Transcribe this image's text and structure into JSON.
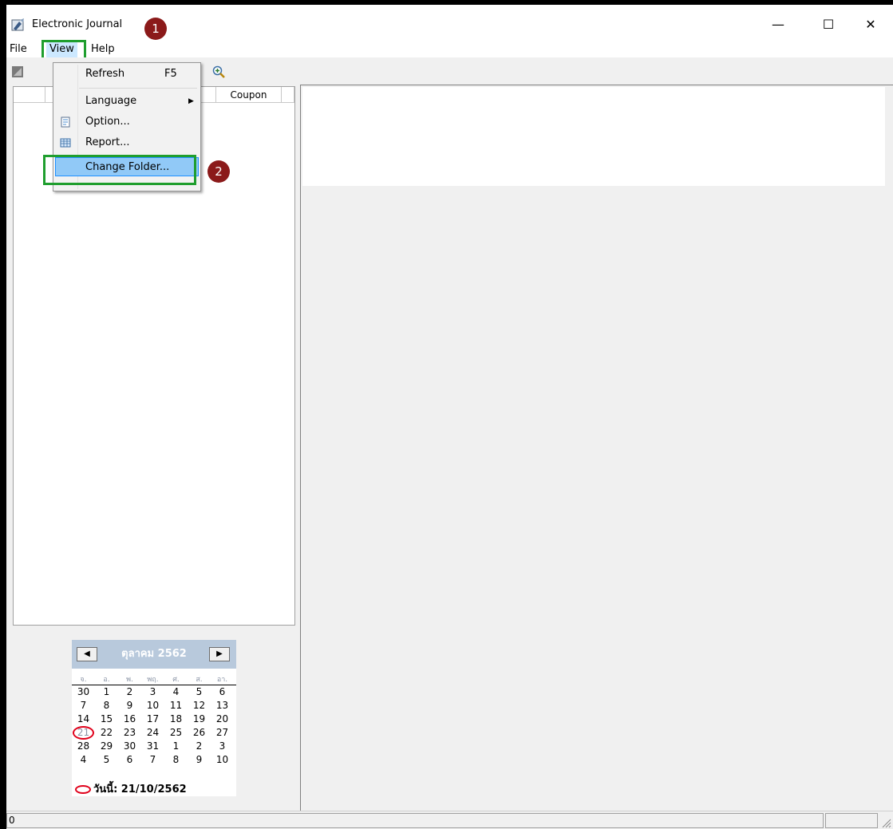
{
  "window": {
    "title": "Electronic Journal",
    "controls": {
      "minimize": "—",
      "maximize": "☐",
      "close": "✕"
    }
  },
  "markers": {
    "step1": "1",
    "step2": "2"
  },
  "menubar": {
    "file": "File",
    "view": "View",
    "help": "Help"
  },
  "view_menu": {
    "refresh": {
      "label": "Refresh",
      "shortcut": "F5"
    },
    "language": {
      "label": "Language"
    },
    "option": {
      "label": "Option..."
    },
    "report": {
      "label": "Report..."
    },
    "change_folder": {
      "label": "Change Folder..."
    }
  },
  "list": {
    "columns": [
      "",
      "",
      "Coupon",
      ""
    ]
  },
  "calendar": {
    "month_title": "ตุลาคม 2562",
    "weekdays": [
      "จ.",
      "อ.",
      "พ.",
      "พฤ.",
      "ศ.",
      "ส.",
      "อา."
    ],
    "weeks": [
      [
        "30",
        "1",
        "2",
        "3",
        "4",
        "5",
        "6"
      ],
      [
        "7",
        "8",
        "9",
        "10",
        "11",
        "12",
        "13"
      ],
      [
        "14",
        "15",
        "16",
        "17",
        "18",
        "19",
        "20"
      ],
      [
        "21",
        "22",
        "23",
        "24",
        "25",
        "26",
        "27"
      ],
      [
        "28",
        "29",
        "30",
        "31",
        "1",
        "2",
        "3"
      ],
      [
        "4",
        "5",
        "6",
        "7",
        "8",
        "9",
        "10"
      ]
    ],
    "today_label": "วันนี้: 21/10/2562"
  },
  "statusbar": {
    "count": "0"
  },
  "colors": {
    "highlight_border": "#1f9e2e",
    "marker": "#8b1a1a",
    "menu_hover": "#91c9f7",
    "calendar_header": "#b8c9dc",
    "today_circle": "#e0001a"
  }
}
